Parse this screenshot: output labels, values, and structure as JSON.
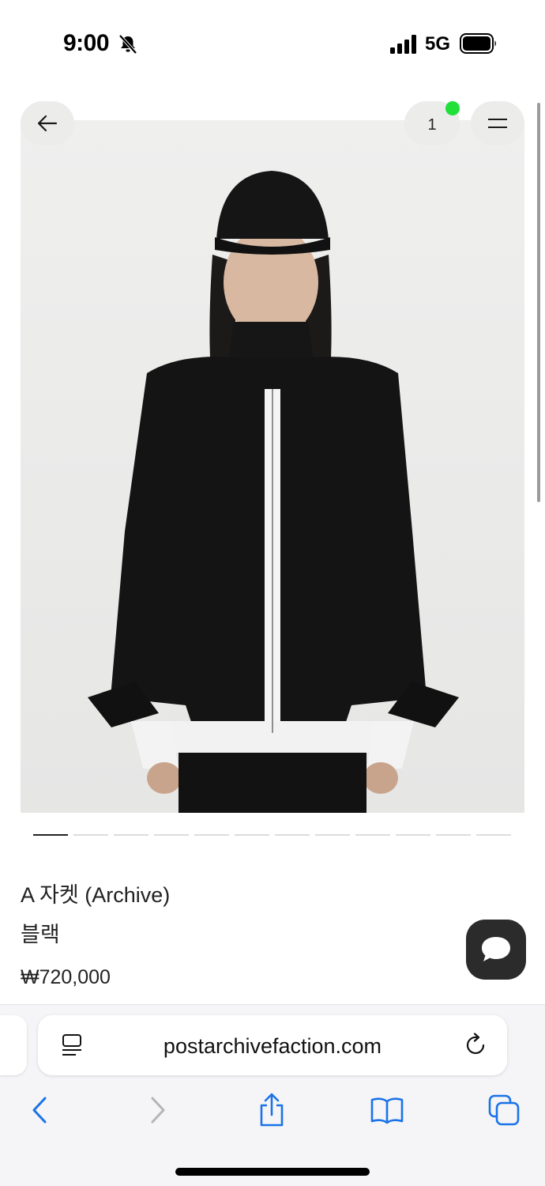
{
  "status": {
    "time": "9:00",
    "network": "5G"
  },
  "nav": {
    "cart_count": "1"
  },
  "gallery": {
    "total_slides": 12,
    "active_slide": 1
  },
  "product": {
    "name": "A 자켓 (Archive)",
    "color": "블랙",
    "price": "₩720,000"
  },
  "browser": {
    "url": "postarchivefaction.com"
  },
  "colors": {
    "accent_blue": "#1a73e8",
    "cart_dot": "#22e03a",
    "chat_button": "#2b2b2b"
  }
}
